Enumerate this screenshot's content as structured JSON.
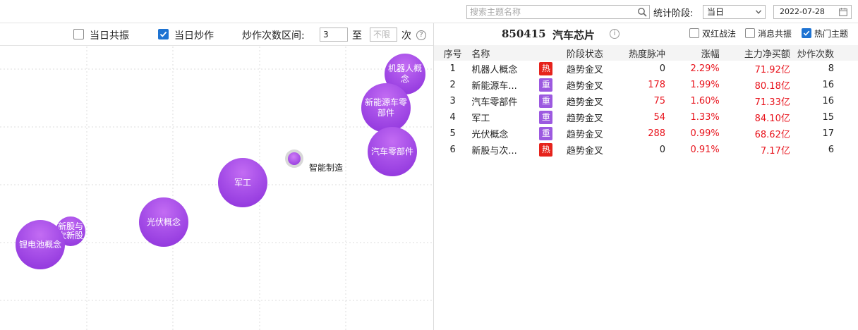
{
  "toolbar": {
    "search_placeholder": "搜索主题名称",
    "stage_label": "统计阶段:",
    "stage_value": "当日",
    "date_value": "2022-07-28"
  },
  "left_panel": {
    "filters": {
      "same_day_resonance": {
        "label": "当日共振",
        "checked": false
      },
      "same_day_hype": {
        "label": "当日炒作",
        "checked": true
      },
      "hype_range_label": "炒作次数区间:",
      "range_min_value": "3",
      "range_to": "至",
      "range_max_placeholder": "不限",
      "range_unit": "次",
      "help_glyph": "?"
    },
    "bubbles": [
      {
        "label": "机器人概念",
        "size": "large"
      },
      {
        "label": "新能源车零部件",
        "size": "large"
      },
      {
        "label": "汽车零部件",
        "size": "large"
      },
      {
        "label": "智能制造",
        "size": "tiny"
      },
      {
        "label": "军工",
        "size": "large"
      },
      {
        "label": "光伏概念",
        "size": "large"
      },
      {
        "label": "新股与次新股",
        "size": "small"
      },
      {
        "label": "锂电池概念",
        "size": "large"
      }
    ]
  },
  "right_panel": {
    "code": "850415",
    "name": "汽车芯片",
    "info_glyph": "i",
    "options": [
      {
        "label": "双红战法",
        "checked": false
      },
      {
        "label": "消息共振",
        "checked": false
      },
      {
        "label": "热门主题",
        "checked": true
      }
    ],
    "columns": [
      "序号",
      "名称",
      "阶段状态",
      "热度脉冲",
      "涨幅",
      "主力净买额",
      "炒作次数"
    ],
    "rows": [
      {
        "idx": "1",
        "name": "机器人概念",
        "tag": "热",
        "tag_type": "hot",
        "stage": "趋势金叉",
        "pulse": "0",
        "pulse_red": false,
        "change": "2.29%",
        "flow": "71.92亿",
        "count": "8"
      },
      {
        "idx": "2",
        "name": "新能源车...",
        "tag": "重",
        "tag_type": "heavy",
        "stage": "趋势金叉",
        "pulse": "178",
        "pulse_red": true,
        "change": "1.99%",
        "flow": "80.18亿",
        "count": "16"
      },
      {
        "idx": "3",
        "name": "汽车零部件",
        "tag": "重",
        "tag_type": "heavy",
        "stage": "趋势金叉",
        "pulse": "75",
        "pulse_red": true,
        "change": "1.60%",
        "flow": "71.33亿",
        "count": "16"
      },
      {
        "idx": "4",
        "name": "军工",
        "tag": "重",
        "tag_type": "heavy",
        "stage": "趋势金叉",
        "pulse": "54",
        "pulse_red": true,
        "change": "1.33%",
        "flow": "84.10亿",
        "count": "15"
      },
      {
        "idx": "5",
        "name": "光伏概念",
        "tag": "重",
        "tag_type": "heavy",
        "stage": "趋势金叉",
        "pulse": "288",
        "pulse_red": true,
        "change": "0.99%",
        "flow": "68.62亿",
        "count": "17"
      },
      {
        "idx": "6",
        "name": "新股与次...",
        "tag": "热",
        "tag_type": "hot",
        "stage": "趋势金叉",
        "pulse": "0",
        "pulse_red": false,
        "change": "0.91%",
        "flow": "7.17亿",
        "count": "6"
      }
    ]
  },
  "colors": {
    "accent_blue": "#1e73d2",
    "bubble_purple": "#a74fe8",
    "up_red": "#e8141d",
    "hot_tag": "#e6231c",
    "heavy_tag": "#9c59e0"
  }
}
